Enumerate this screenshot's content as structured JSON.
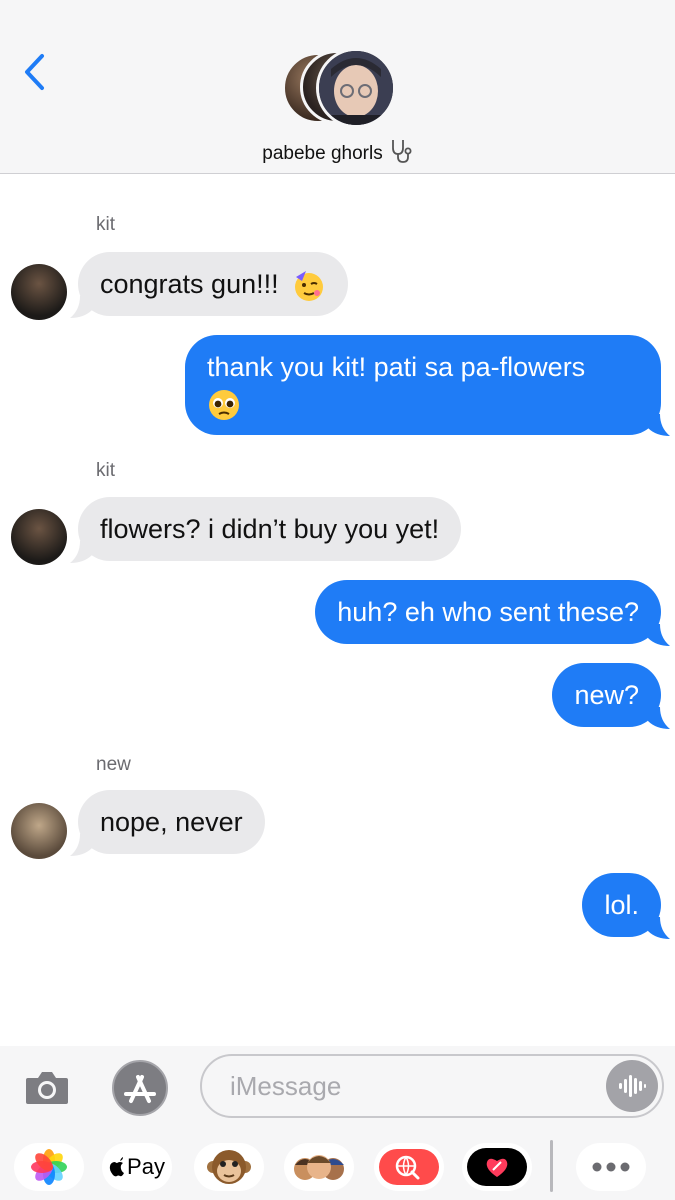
{
  "header": {
    "group_name": "pabebe ghorls",
    "badge_icon": "stethoscope-icon"
  },
  "messages": [
    {
      "sender": "kit",
      "direction": "in",
      "text": "congrats gun!!!",
      "emoji": "partying-face-emoji"
    },
    {
      "direction": "out",
      "line1": "thank you kit! pati sa pa-flowers",
      "emoji": "pleading-face-emoji"
    },
    {
      "sender": "kit",
      "direction": "in",
      "text": "flowers? i didn’t buy you yet!"
    },
    {
      "direction": "out",
      "text": "huh? eh who sent these?"
    },
    {
      "direction": "out",
      "text": "new?"
    },
    {
      "sender": "new",
      "direction": "in",
      "text": "nope, never"
    },
    {
      "direction": "out",
      "text": "lol."
    }
  ],
  "compose": {
    "placeholder": "iMessage",
    "apple_pay_label": "Pay"
  },
  "colors": {
    "outgoing_bubble": "#1f7cf6",
    "incoming_bubble": "#e9e9eb",
    "back_chevron": "#1f7cf6"
  }
}
